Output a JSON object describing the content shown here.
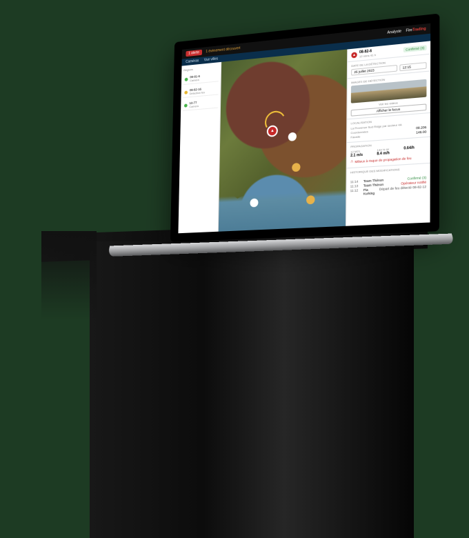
{
  "topbar": {
    "alert_count": "1 alerte",
    "alert_text": "1 évènement découvert",
    "user": "Analyste",
    "brand_a": "Fire",
    "brand_b": "Trading"
  },
  "bluebar": {
    "tab1": "Caméras",
    "tab2": "Vue villes"
  },
  "sidebar": {
    "title": "Régions",
    "items": [
      {
        "color": "g",
        "code": "08-81-6",
        "sub": "Camera"
      },
      {
        "color": "y",
        "code": "09-82-16",
        "sub": "Détection feu"
      },
      {
        "color": "g",
        "code": "10-77",
        "sub": "Camera"
      }
    ]
  },
  "panel": {
    "id": "08-82-6",
    "sub": "12 mins 41 h",
    "status": "Confirmé (3)",
    "sec_date": "DATE DE LA DÉTECTION",
    "date": "25 juillet 2023",
    "time": "12:15",
    "sec_img": "IMAGES DE DÉTECTION",
    "all_shots": "Voir les vidéos",
    "btn_zoom": "Afficher le focus",
    "sec_loc": "LOCALISATION",
    "loc_desc": "La Provence  Sud Ridge par secteur 4A",
    "coord_lbl": "Coordonnées",
    "coord_v": "08.206",
    "face_lbl": "Facade",
    "face_v": "146.00",
    "sec_prop": "PROPAGATION",
    "p1l": "12 M21",
    "p1v": "2.1 m/s",
    "p2l": "144 % W",
    "p2v": "8.4 m/h",
    "p3l": "",
    "p3v": "0.64/h",
    "warn": "Milieux à risque de propagation de feu",
    "sec_hist": "HISTORIQUE DES MODIFICATIONS",
    "hist": [
      {
        "t": "11:14",
        "w": "Team Thénon",
        "s": "Confirmé (3)",
        "cls": "green"
      },
      {
        "t": "11:13",
        "w": "Team Thénon",
        "s": "Opérateur notifié",
        "cls": "red"
      },
      {
        "t": "11:12",
        "w": "Pia Kurking",
        "s": "Départ de feu détecté 08-82-12",
        "cls": "gray"
      }
    ]
  }
}
